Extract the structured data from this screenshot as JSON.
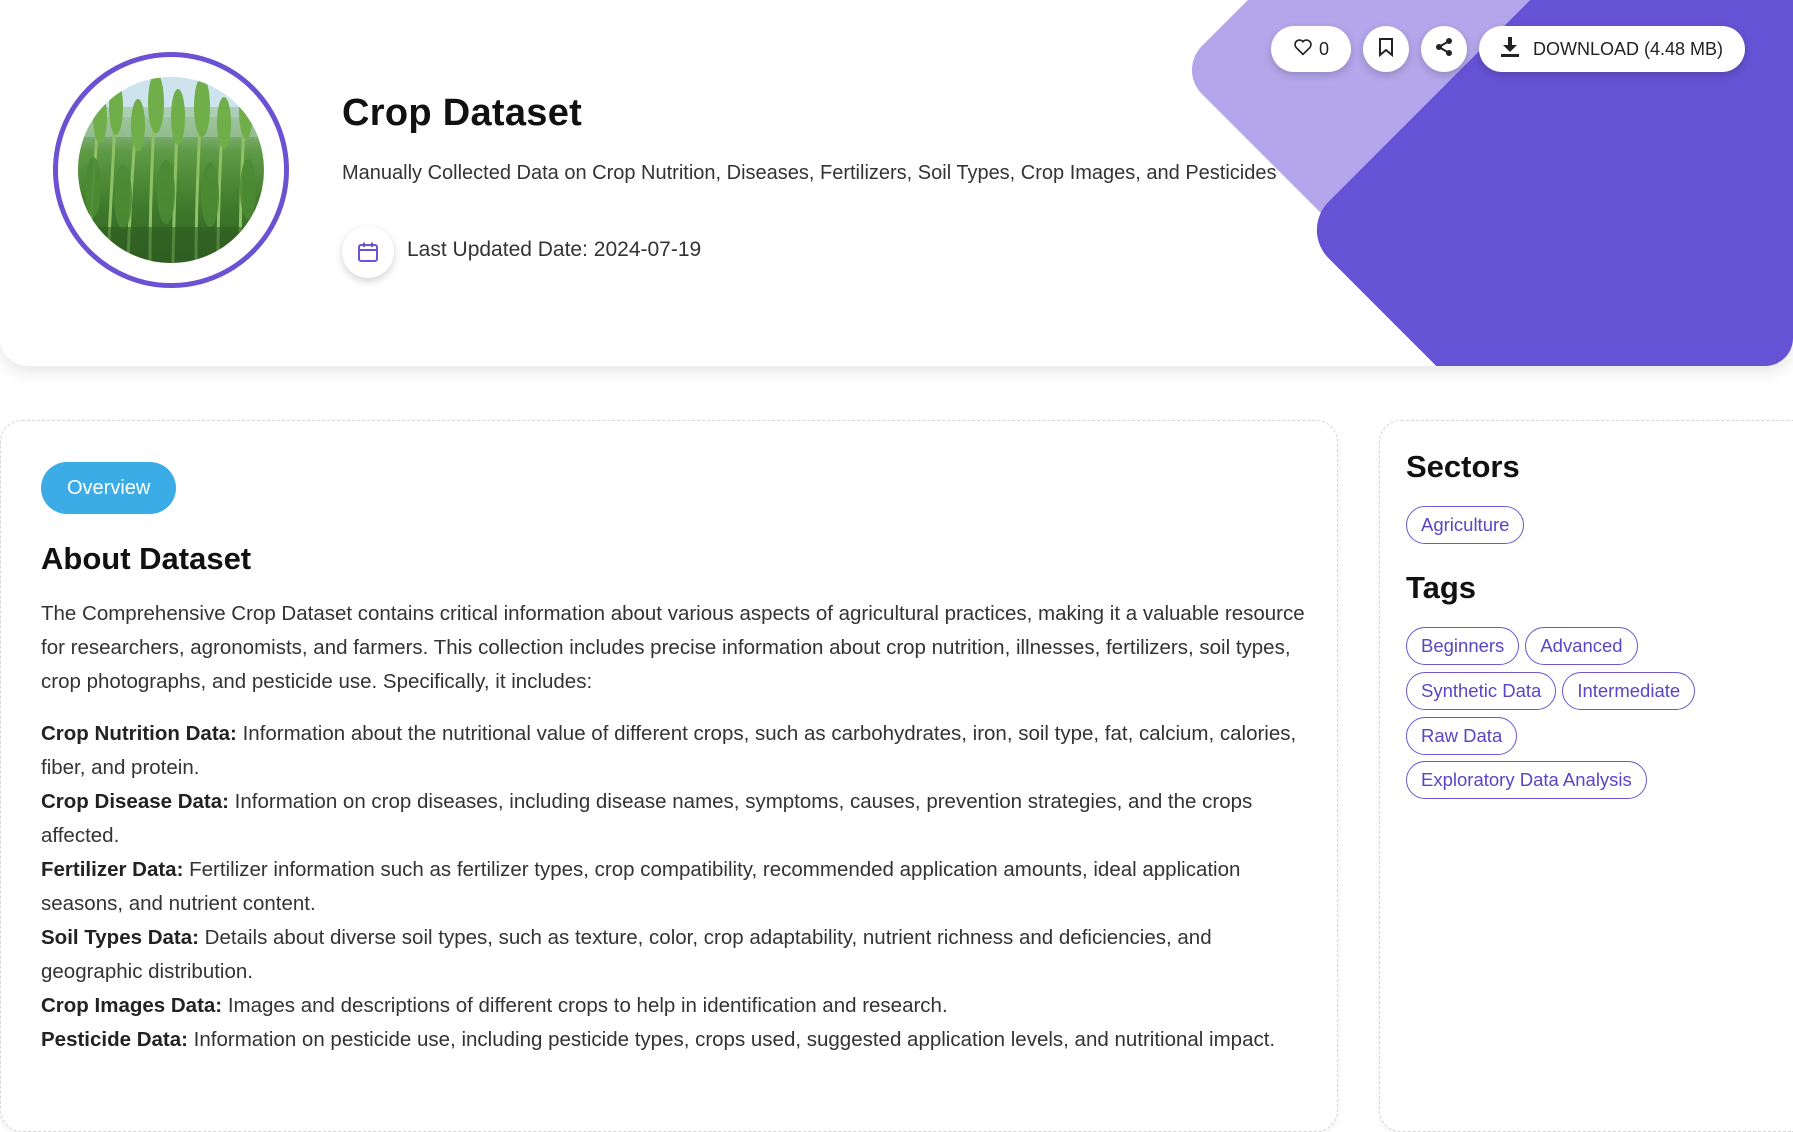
{
  "header": {
    "title": "Crop Dataset",
    "subtitle": "Manually Collected Data on Crop Nutrition, Diseases, Fertilizers, Soil Types, Crop Images, and Pesticides",
    "last_updated": "Last Updated Date: 2024-07-19",
    "like_count": "0",
    "download_label": "DOWNLOAD (4.48 MB)"
  },
  "tabs": [
    {
      "label": "Overview",
      "active": true
    }
  ],
  "about": {
    "title": "About Dataset",
    "intro": "The Comprehensive Crop Dataset contains critical information about various aspects of agricultural practices, making it a valuable resource for researchers, agronomists, and farmers. This collection includes precise information about crop nutrition, illnesses, fertilizers, soil types, crop photographs, and pesticide use. Specifically, it includes:",
    "items": [
      {
        "label": "Crop Nutrition Data:",
        "text": " Information about the nutritional value of different crops, such as carbohydrates, iron, soil type, fat, calcium, calories, fiber, and protein."
      },
      {
        "label": "Crop Disease Data:",
        "text": " Information on crop diseases, including disease names, symptoms, causes, prevention strategies, and the crops affected."
      },
      {
        "label": "Fertilizer Data:",
        "text": " Fertilizer information such as fertilizer types, crop compatibility, recommended application amounts, ideal application seasons, and nutrient content."
      },
      {
        "label": "Soil Types Data:",
        "text": " Details about diverse soil types, such as texture, color, crop adaptability, nutrient richness and deficiencies, and geographic distribution."
      },
      {
        "label": "Crop Images Data:",
        "text": " Images and descriptions of different crops to help in identification and research."
      },
      {
        "label": "Pesticide Data:",
        "text": " Information on pesticide use, including pesticide types, crops used, suggested application levels, and nutritional impact."
      }
    ]
  },
  "sidebar": {
    "sectors_title": "Sectors",
    "sectors": [
      "Agriculture"
    ],
    "tags_title": "Tags",
    "tags": [
      "Beginners",
      "Advanced",
      "Synthetic Data",
      "Intermediate",
      "Raw Data",
      "Exploratory Data Analysis"
    ]
  },
  "colors": {
    "accent_purple": "#6652d4",
    "accent_light_purple": "#b3a6ea",
    "tab_blue": "#3cace6",
    "chip_text": "#5a45c4"
  },
  "icons": [
    "heart-icon",
    "bookmark-icon",
    "share-icon",
    "download-icon",
    "calendar-icon"
  ]
}
